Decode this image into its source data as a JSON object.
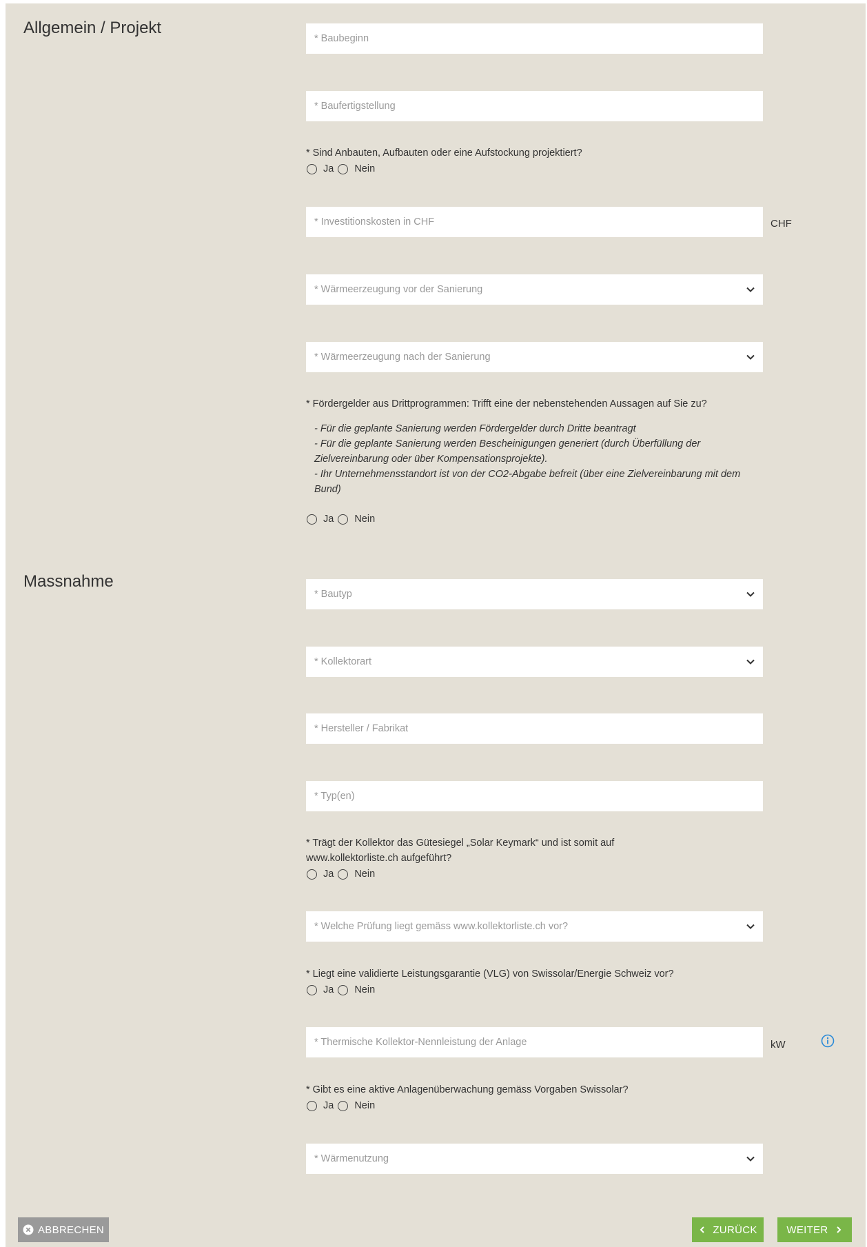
{
  "sections": {
    "general": "Allgemein / Projekt",
    "measure": "Massnahme"
  },
  "fields": {
    "baubeginn": "* Baubeginn",
    "baufertigstellung": "* Baufertigstellung",
    "investitionskosten": "* Investitionskosten in CHF",
    "investitionskosten_unit": "CHF",
    "waerme_vor": "* Wärmeerzeugung vor der Sanierung",
    "waerme_nach": "* Wärmeerzeugung nach der Sanierung",
    "bautyp": "* Bautyp",
    "kollektorart": "* Kollektorart",
    "hersteller": "* Hersteller / Fabrikat",
    "typen": "* Typ(en)",
    "pruefung": "* Welche Prüfung liegt gemäss www.kollektorliste.ch vor?",
    "nennleistung": "* Thermische Kollektor-Nennleistung der Anlage",
    "nennleistung_unit": "kW",
    "waermenutzung": "* Wärmenutzung"
  },
  "questions": {
    "anbauten": "* Sind Anbauten, Aufbauten oder eine Aufstockung projektiert?",
    "foerdergelder": "* Fördergelder aus Drittprogrammen: Trifft eine der nebenstehenden Aussagen auf Sie zu?",
    "guetesiegel_line1": "* Trägt der Kollektor das Gütesiegel „Solar Keymark“ und ist somit auf",
    "guetesiegel_line2": "www.kollektorliste.ch aufgeführt?",
    "vlg": "* Liegt eine validierte Leistungsgarantie (VLG) von Swissolar/Energie Schweiz vor?",
    "ueberwachung": "* Gibt es eine aktive Anlagenüberwachung gemäss Vorgaben Swissolar?"
  },
  "foerder_notes": [
    "- Für die geplante Sanierung werden Fördergelder durch Dritte beantragt",
    "- Für die geplante Sanierung werden Bescheinigungen generiert (durch Überfüllung der",
    "Zielvereinbarung oder über Kompensationsprojekte).",
    "- Ihr Unternehmensstandort ist von der CO2-Abgabe befreit (über eine Zielvereinbarung mit dem",
    "Bund)"
  ],
  "radio": {
    "yes": "Ja",
    "no": "Nein"
  },
  "buttons": {
    "cancel": "ABBRECHEN",
    "back": "ZURÜCK",
    "next": "WEITER"
  },
  "colors": {
    "background": "#e4e0d6",
    "accent_green": "#7ab648",
    "cancel_gray": "#9a9a9a",
    "info_blue": "#2a8ad8"
  },
  "icons": [
    "chevron-down-icon",
    "close-circle-icon",
    "chevron-left-icon",
    "chevron-right-icon",
    "info-icon"
  ]
}
